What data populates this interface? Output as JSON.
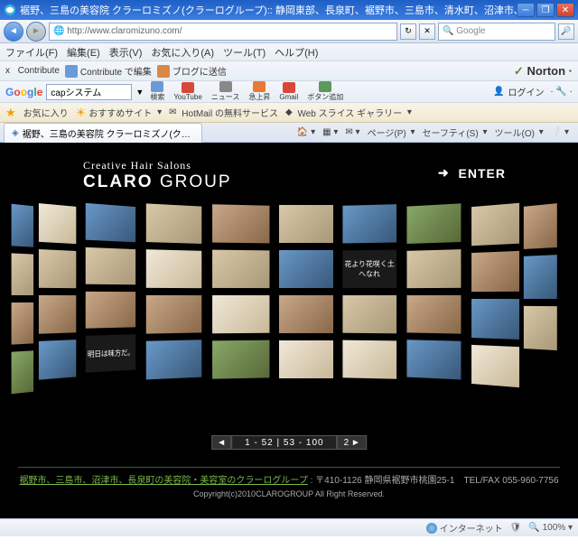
{
  "window": {
    "title": "裾野、三島の美容院 クラーロミズノ(クラーログループ):: 静岡東部、長泉町、裾野市、三島市、清水町、沼津市、御殿場市エリア 美容室 美容院く - Windows Int..."
  },
  "nav": {
    "url": "http://www.claromizuno.com/",
    "search_placeholder": "Google"
  },
  "menu": [
    "ファイル(F)",
    "編集(E)",
    "表示(V)",
    "お気に入り(A)",
    "ツール(T)",
    "ヘルプ(H)"
  ],
  "contribute_row": {
    "x": "x",
    "contribute": "Contribute",
    "contrib_edit": "Contribute で編集",
    "blog": "ブログに送信"
  },
  "norton": "Norton",
  "google_row": {
    "search_value": "capシステム",
    "buttons": [
      "検索",
      "YouTube",
      "ニュース",
      "急上昇",
      "Gmail",
      "ボタン追加"
    ],
    "login": "ログイン"
  },
  "fav_row": {
    "fav": "お気に入り",
    "suggest": "おすすめサイト",
    "hotmail": "HotMail の無料サービス",
    "slice": "Web スライス ギャラリー"
  },
  "tab": {
    "text": "裾野、三島の美容院 クラーロミズノ(クラーログループ)::..."
  },
  "tab_tools": [
    "ページ(P)",
    "セーフティ(S)",
    "ツール(O)"
  ],
  "page": {
    "logo_sub": "Creative Hair Salons",
    "logo_bold": "CLARO",
    "logo_light": " GROUP",
    "enter": "ENTER",
    "pager_prev": "◄",
    "pager_mid": "1 - 52 | 53 - 100",
    "pager_next": "2   ►",
    "footer_link": "裾野市、三島市、沼津市、長泉町の美容院・美容室のクラーログループ",
    "footer_rest": " : 〒410-1126 静岡県裾野市桃園25-1　TEL/FAX 055-960-7756",
    "copyright": "Copyright(c)2010CLAROGROUP All Right Reserved."
  },
  "status": {
    "zone": "インターネット",
    "zoom": "100%"
  },
  "thumb_txt1": "明日は味方だ。",
  "thumb_txt2": "花より花咲く土へなれ"
}
